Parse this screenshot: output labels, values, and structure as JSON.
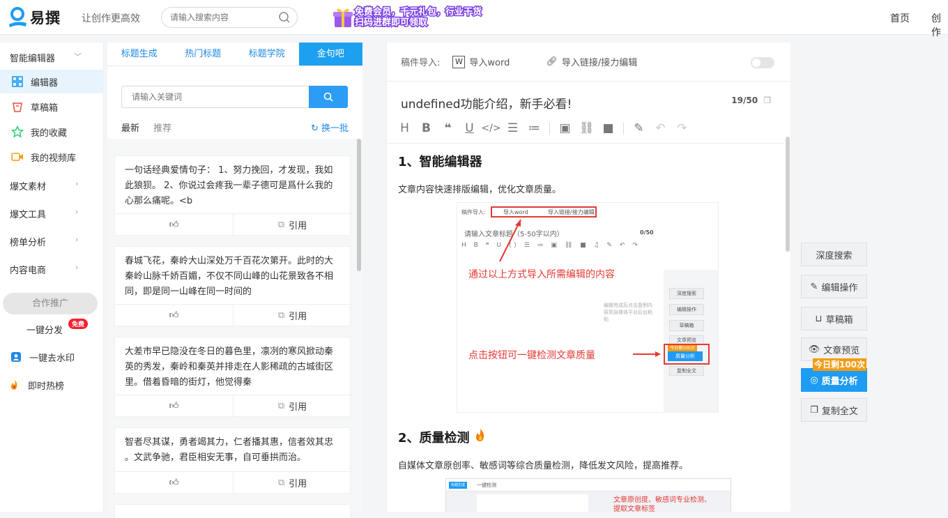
{
  "header": {
    "logo_text": "易撰",
    "slogan": "让创作更高效",
    "search_placeholder": "请输入搜索内容",
    "banner_line1": "免费会员，千元礼包，行业干货",
    "banner_line2": "扫码进群即可领取",
    "nav": [
      "首页",
      "创作"
    ]
  },
  "sidebar": {
    "editor_group": "智能编辑器",
    "items": [
      {
        "label": "编辑器",
        "icon": "grid-icon"
      },
      {
        "label": "草稿箱",
        "icon": "draft-box-icon"
      },
      {
        "label": "我的收藏",
        "icon": "star-icon"
      },
      {
        "label": "我的视频库",
        "icon": "video-icon"
      }
    ],
    "groups": [
      "爆文素材",
      "爆文工具",
      "榜单分析",
      "内容电商"
    ],
    "coop": "合作推广",
    "one_click_distribute": "一键分发",
    "free_badge": "免费",
    "watermark": "一键去水印",
    "hot_list": "即时热榜"
  },
  "middle": {
    "tabs": [
      "标题生成",
      "热门标题",
      "标题学院",
      "金句吧"
    ],
    "keyword_placeholder": "请输入关键词",
    "subtabs": [
      "最新",
      "推荐"
    ],
    "refresh": "换一批",
    "cite_label": "引用",
    "cards": [
      "一句话经典爱情句子： 1、努力挽回，才发现，我如此狼狈。 2、你说过会疼我一辈子德可是爲什么我的心那么痛呢。<b",
      "春城飞花，秦岭大山深处万千百花次第开。此时的大秦岭山脉千娇百媚，不仅不同山峰的山花景致各不相同，即是同一山峰在同一时间的",
      "大差市早已隐没在冬日的暮色里，凛冽的寒风掀动秦英的秀发，秦岭和秦英并排走在人影稀疏的古城街区里。借着昏暗的街灯，他觉得秦",
      "智者尽其谋，勇者竭其力，仁者播其惠，信者效其忠 。文武争驰，君臣相安无事，自可垂拱而治。"
    ]
  },
  "editor": {
    "import_label": "稿件导入:",
    "import_word": "导入word",
    "import_link": "导入链接/接力编辑",
    "title": "undefined功能介绍，新手必看!",
    "count": "19/50",
    "h1": "1、智能编辑器",
    "p1": "文章内容快速排版编辑，优化文章质量。",
    "h2": "2、质量检测",
    "p2": "自媒体文章原创率、敏感词等综合质量检测，降低发文风险，提高推荐。",
    "shot": {
      "import_label": "稿件导入:",
      "import_word": "导入word",
      "import_link": "导入链接/接力编辑",
      "title_placeholder": "请输入文章标题（5-50字以内）",
      "count": "0/50",
      "annotation1": "通过以上方式导入所需编辑的内容",
      "annotation2": "点击按钮可一键检测文章质量",
      "hint": "编辑完成后点击复制内容到自媒体平台后台粘贴",
      "side": [
        "深度搜索",
        "编辑操作",
        "草稿箱",
        "文章预览",
        "质量分析",
        "复制全文"
      ],
      "today": "今日剩100次"
    },
    "shot2": {
      "header": "一键检测",
      "annotation": "文章原创度、敏感词专业检测、提取文章标签",
      "tab": "标题生成"
    }
  },
  "right_panel": {
    "buttons": [
      "深度搜索",
      "编辑操作",
      "草稿箱",
      "文章预览",
      "质量分析",
      "复制全文"
    ],
    "today_badge": "今日剩100次"
  }
}
